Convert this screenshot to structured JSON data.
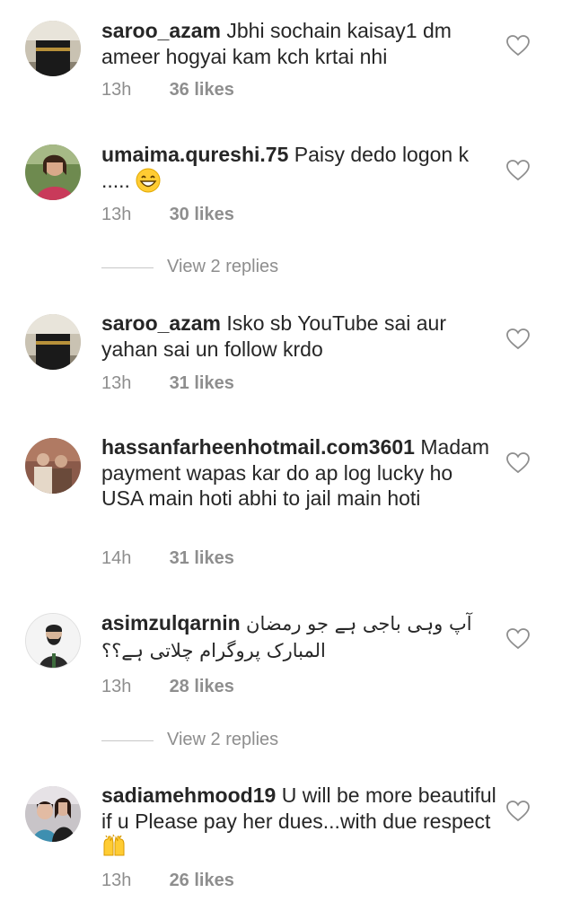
{
  "comments": [
    {
      "username": "saroo_azam",
      "text": "Jbhi sochain kaisay1 dm ameer hogyai kam kch krtai nhi",
      "time": "13h",
      "likes": "36 likes",
      "avatar": "kaaba-icon"
    },
    {
      "username": "umaima.qureshi.75",
      "text": "Paisy dedo logon k .....",
      "emoji": "grinning-face-emoji",
      "time": "13h",
      "likes": "30 likes",
      "avatar": "woman-photo-icon"
    },
    {
      "username": "saroo_azam",
      "text": "Isko sb YouTube sai aur yahan sai un follow krdo",
      "time": "13h",
      "likes": "31 likes",
      "avatar": "kaaba-icon"
    },
    {
      "username": "hassanfarheenhotmail.com3601",
      "text": "Madam payment wapas kar do ap  log lucky ho USA main hoti abhi to jail main hoti",
      "time": "14h",
      "likes": "31 likes",
      "avatar": "family-photo-icon"
    },
    {
      "username": "asimzulqarnin",
      "text": "آپ وہی باجی ہے جو رمضان المبارک پروگرام چلاتی ہے؟؟",
      "time": "13h",
      "likes": "28 likes",
      "avatar": "bearded-man-icon"
    },
    {
      "username": "sadiamehmood19",
      "text": "U will be more beautiful if u Please pay her dues...with due respect",
      "emoji": "raising-hands-emoji",
      "time": "13h",
      "likes": "26 likes",
      "avatar": "two-girls-photo-icon"
    }
  ],
  "view_replies": [
    {
      "label": "View 2 replies"
    },
    {
      "label": "View 2 replies"
    }
  ],
  "colors": {
    "text": "#262626",
    "secondary": "#8e8e8e",
    "divider": "#c7c7c7"
  }
}
